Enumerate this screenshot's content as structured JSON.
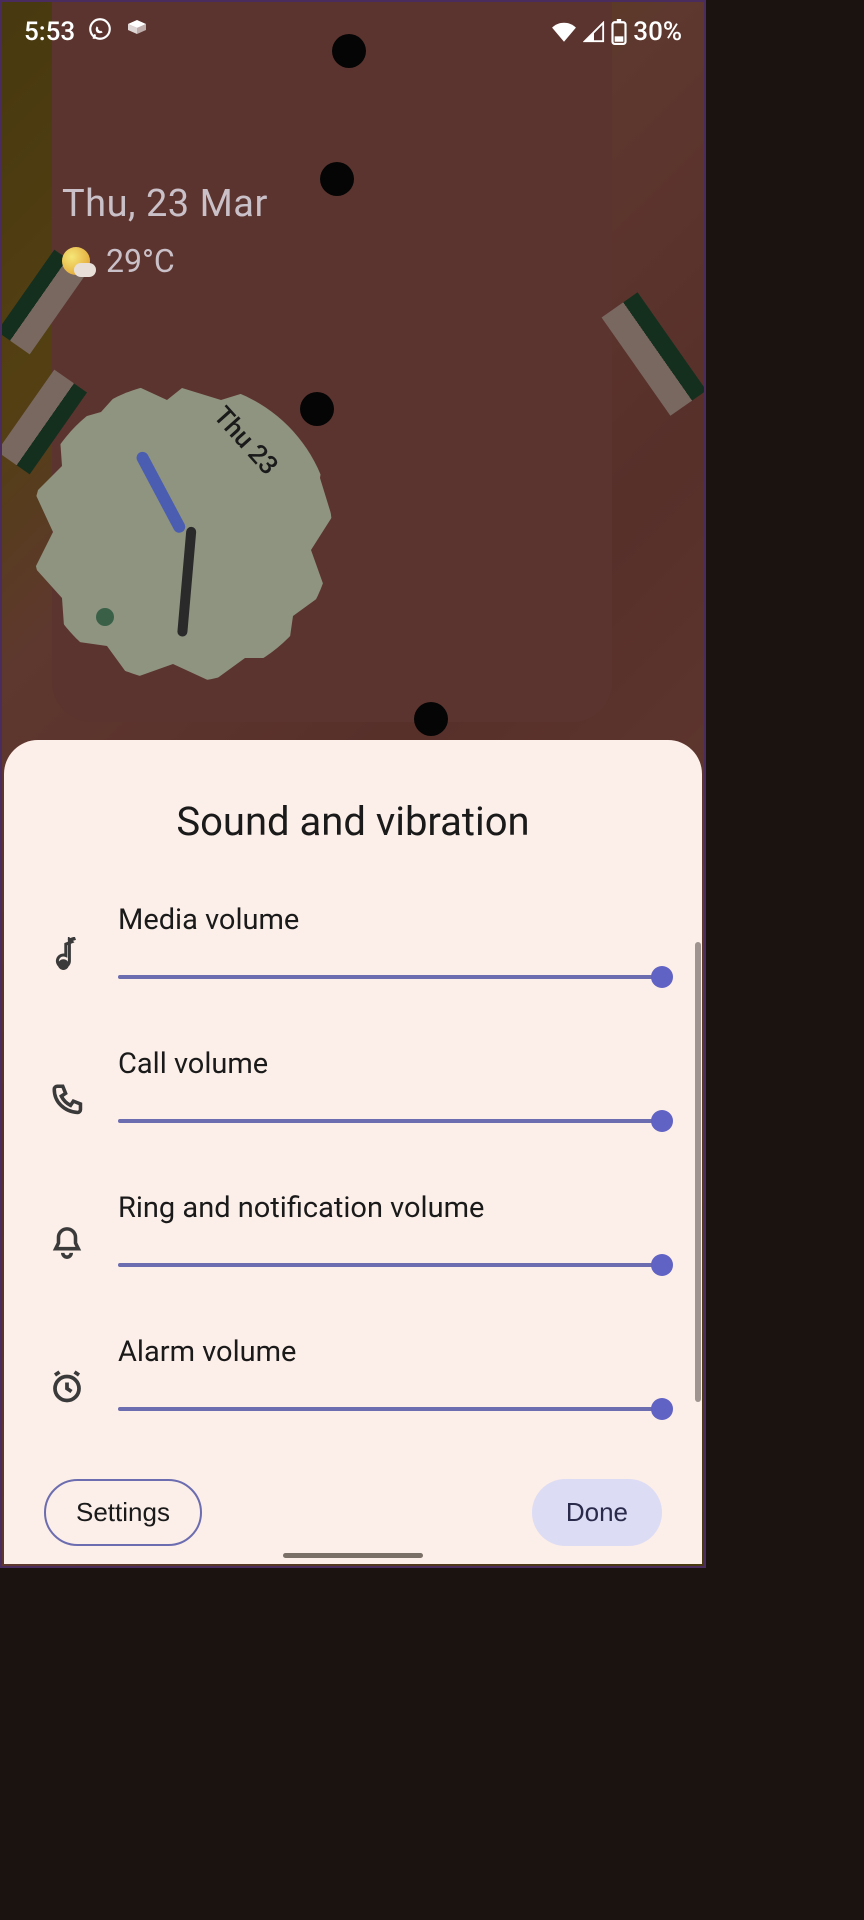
{
  "statusbar": {
    "time": "5:53",
    "battery_pct": "30%"
  },
  "home": {
    "date": "Thu, 23 Mar",
    "temperature": "29°C",
    "clock_day": "Thu 23"
  },
  "sheet": {
    "title": "Sound and vibration",
    "sliders": [
      {
        "label": "Media volume",
        "value": 100
      },
      {
        "label": "Call volume",
        "value": 100
      },
      {
        "label": "Ring and notification volume",
        "value": 100
      },
      {
        "label": "Alarm volume",
        "value": 100
      }
    ],
    "settings_label": "Settings",
    "done_label": "Done"
  },
  "colors": {
    "accent": "#6062c4",
    "sheet_bg": "#fceee8"
  }
}
